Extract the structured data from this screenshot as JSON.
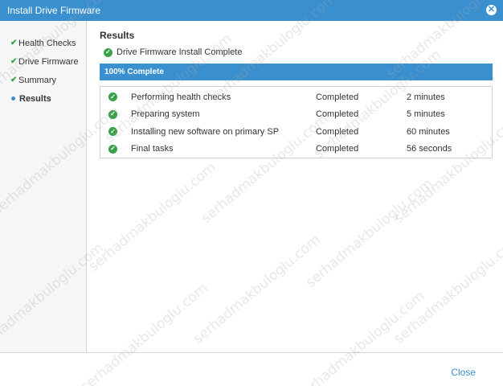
{
  "window": {
    "title": "Install Drive Firmware"
  },
  "steps": [
    {
      "label": "Health Checks",
      "state": "done"
    },
    {
      "label": "Drive Firmware",
      "state": "done"
    },
    {
      "label": "Summary",
      "state": "done"
    },
    {
      "label": "Results",
      "state": "active"
    }
  ],
  "results": {
    "heading": "Results",
    "complete_message": "Drive Firmware Install Complete",
    "progress_label": "100% Complete",
    "progress_fraction": 1.0
  },
  "tasks": [
    {
      "name": "Performing health checks",
      "status": "Completed",
      "duration": "2 minutes"
    },
    {
      "name": "Preparing system",
      "status": "Completed",
      "duration": "5 minutes"
    },
    {
      "name": "Installing new software on primary SP",
      "status": "Completed",
      "duration": "60 minutes"
    },
    {
      "name": "Final tasks",
      "status": "Completed",
      "duration": "56 seconds"
    }
  ],
  "footer": {
    "close_label": "Close"
  },
  "watermark": "serhadmakbuloglu.com",
  "colors": {
    "accent": "#3a8fcf",
    "success": "#3aa04a"
  },
  "icons": {
    "close": "close-circle-icon",
    "step_done": "checkmark-icon",
    "step_active": "bullet-icon",
    "task_done": "check-circle-icon"
  }
}
